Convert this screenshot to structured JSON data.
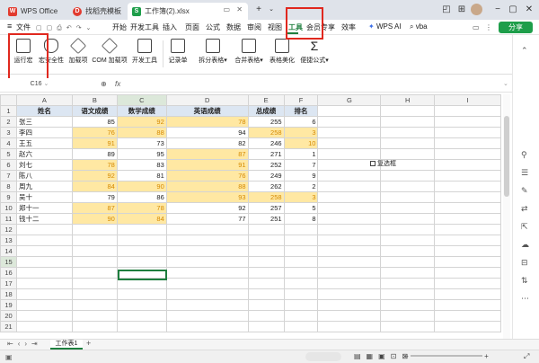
{
  "tabs": {
    "wps_label": "WPS Office",
    "template_label": "找稻壳模板",
    "doc_label": "工作簿(2).xlsx"
  },
  "menubar": {
    "file_label": "文件",
    "items": [
      "开始",
      "开发工具",
      "插入",
      "页面",
      "公式",
      "数据",
      "审阅",
      "视图",
      "工具",
      "会员专享",
      "效率"
    ],
    "wps_ai": "WPS AI",
    "vba": "vba",
    "share": "分享"
  },
  "ribbon": {
    "buttons": [
      "运行宏",
      "宏安全性",
      "加载项",
      "COM 加载项",
      "开发工具",
      "记录单",
      "拆分表格",
      "合并表格",
      "表格美化",
      "便捷公式"
    ]
  },
  "formula_bar": {
    "cell_ref": "C16",
    "fx": "fx"
  },
  "sheet": {
    "columns": [
      "A",
      "B",
      "C",
      "D",
      "E",
      "F",
      "G",
      "H",
      "I"
    ],
    "rows": [
      "1",
      "2",
      "3",
      "4",
      "5",
      "6",
      "7",
      "8",
      "9",
      "10",
      "11",
      "12",
      "13",
      "14",
      "15",
      "16",
      "17",
      "18",
      "19",
      "20",
      "21"
    ],
    "headers": [
      "姓名",
      "语文成绩",
      "数学成绩",
      "英语成绩",
      "总成绩",
      "排名"
    ],
    "data": [
      [
        "张三",
        "85",
        "92",
        "78",
        "255",
        "6"
      ],
      [
        "李四",
        "76",
        "88",
        "94",
        "258",
        "3"
      ],
      [
        "王五",
        "91",
        "73",
        "82",
        "246",
        "10"
      ],
      [
        "赵六",
        "89",
        "95",
        "87",
        "271",
        "1"
      ],
      [
        "刘七",
        "78",
        "83",
        "91",
        "252",
        "7"
      ],
      [
        "陈八",
        "92",
        "81",
        "76",
        "249",
        "9"
      ],
      [
        "周九",
        "84",
        "90",
        "88",
        "262",
        "2"
      ],
      [
        "吴十",
        "79",
        "86",
        "93",
        "258",
        "3"
      ],
      [
        "郑十一",
        "87",
        "78",
        "92",
        "257",
        "5"
      ],
      [
        "钱十二",
        "90",
        "84",
        "77",
        "251",
        "8"
      ]
    ],
    "checkbox_label": "复选框"
  },
  "sheet_tabs": {
    "active": "工作表1"
  },
  "colors": {
    "accent": "#1e7e3e",
    "highlight": "#ffe8a3",
    "red_box": "#e0281e"
  }
}
